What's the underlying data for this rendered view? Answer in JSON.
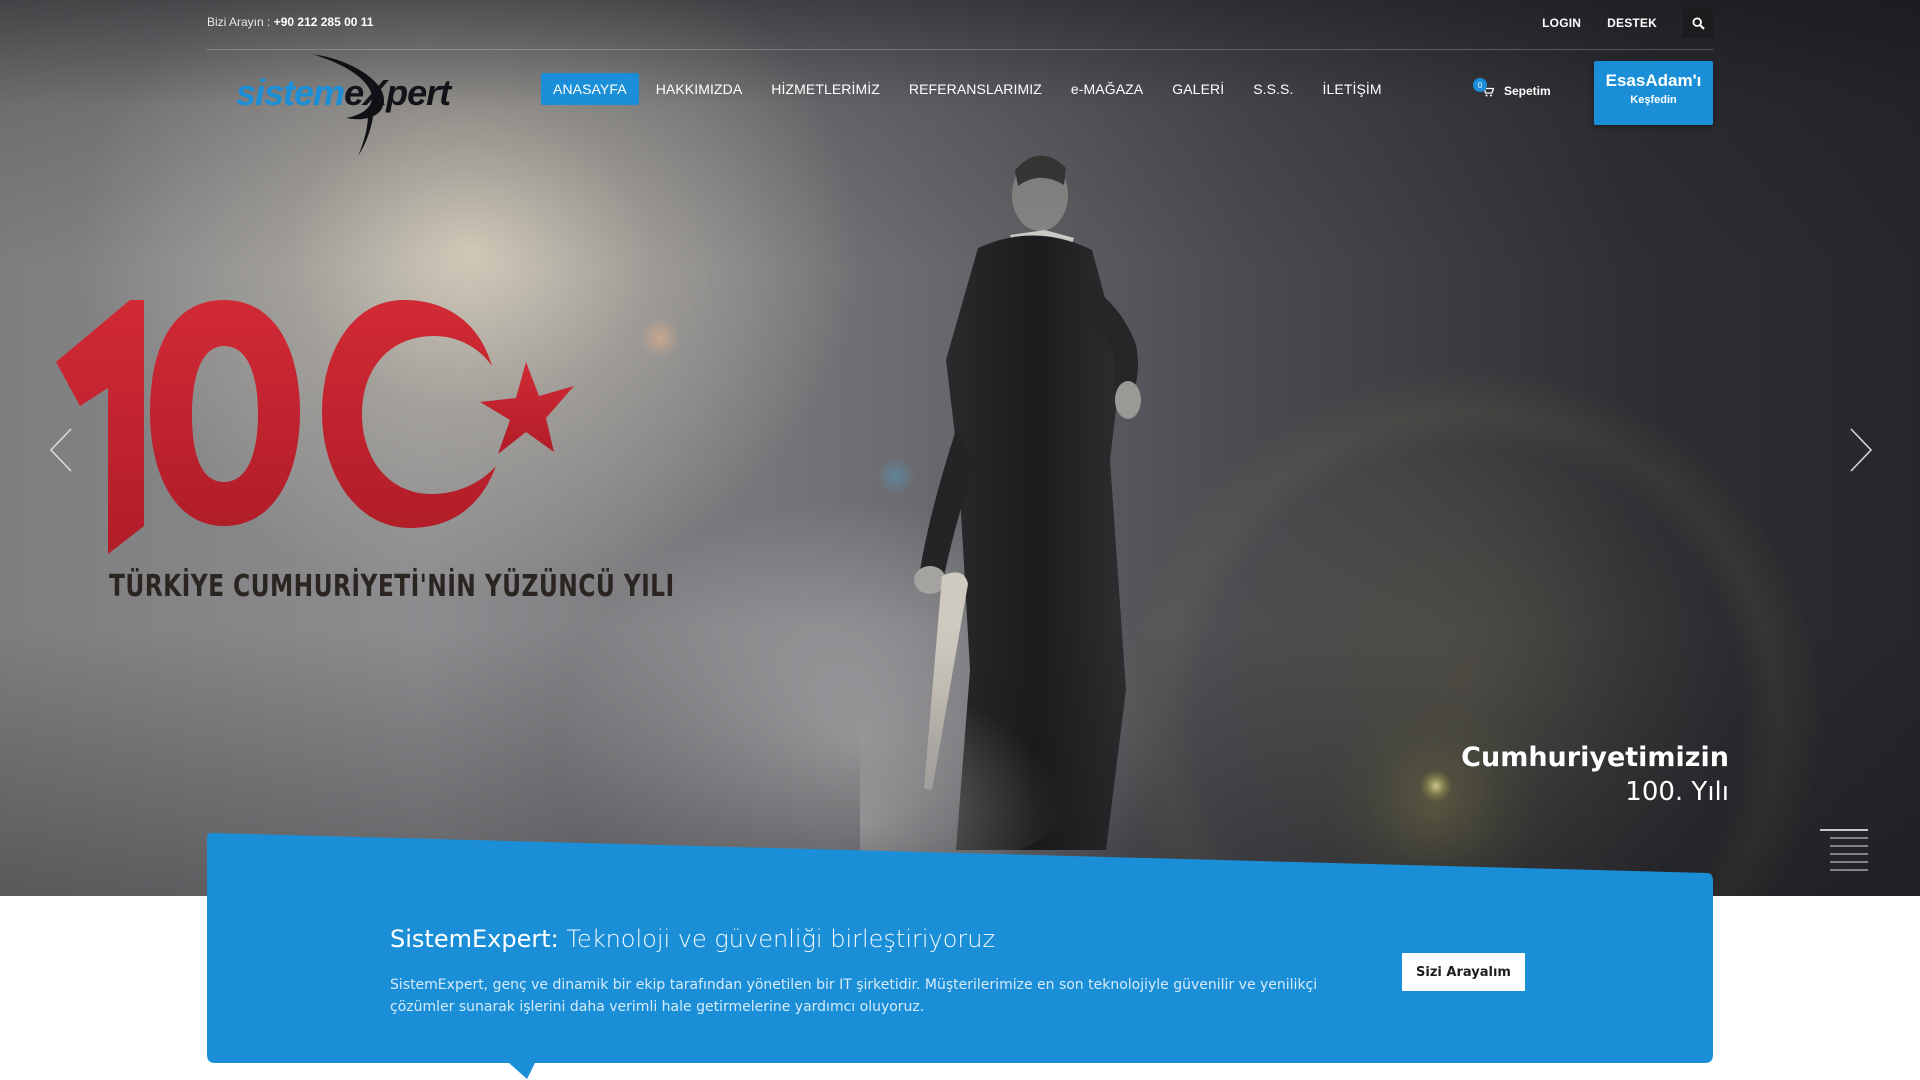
{
  "topbar": {
    "phone_label": "Bizi Arayın :",
    "phone_number": "+90 212 285 00 11",
    "login": "LOGIN",
    "support": "DESTEK",
    "search_icon": "search-icon"
  },
  "logo": {
    "part1": "sistem",
    "part2": "e",
    "part3": "X",
    "part4": "pert"
  },
  "nav": {
    "items": [
      {
        "label": "ANASAYFA",
        "active": true
      },
      {
        "label": "HAKKIMIZDA",
        "active": false
      },
      {
        "label": "HİZMETLERİMİZ",
        "active": false
      },
      {
        "label": "REFERANSLARIMIZ",
        "active": false
      },
      {
        "label": "e-MAĞAZA",
        "active": false
      },
      {
        "label": "GALERİ",
        "active": false
      },
      {
        "label": "S.S.S.",
        "active": false
      },
      {
        "label": "İLETİŞİM",
        "active": false
      }
    ],
    "cart": {
      "count": "0",
      "label": "Sepetim",
      "icon": "cart-icon"
    },
    "cta": {
      "title": "EsasAdam'ı",
      "subtitle": "Keşfedin"
    }
  },
  "hero": {
    "centennial_caption": "TÜRKİYE CUMHURİYETİ'NİN YÜZÜNCÜ YILI",
    "caption_bold": "Cumhuriyetimizin",
    "caption_light": "100. Yılı",
    "prev_icon": "chevron-left-icon",
    "next_icon": "chevron-right-icon",
    "menu_icon": "slide-list-icon"
  },
  "band": {
    "title_brand": "SistemExpert:",
    "title_rest": "Teknoloji ve güvenliği birleştiriyoruz",
    "description": "SistemExpert, genç ve dinamik bir ekip tarafından yönetilen bir IT şirketidir. Müşterilerimize en son teknolojiyle güvenilir ve yenilikçi çözümler sunarak işlerini daha verimli hale getirmelerine yardımcı oluyoruz.",
    "button": "Sizi Arayalım"
  },
  "colors": {
    "accent": "#1a8fd8",
    "red": "#c3222e",
    "dark": "#1c1c1e"
  }
}
